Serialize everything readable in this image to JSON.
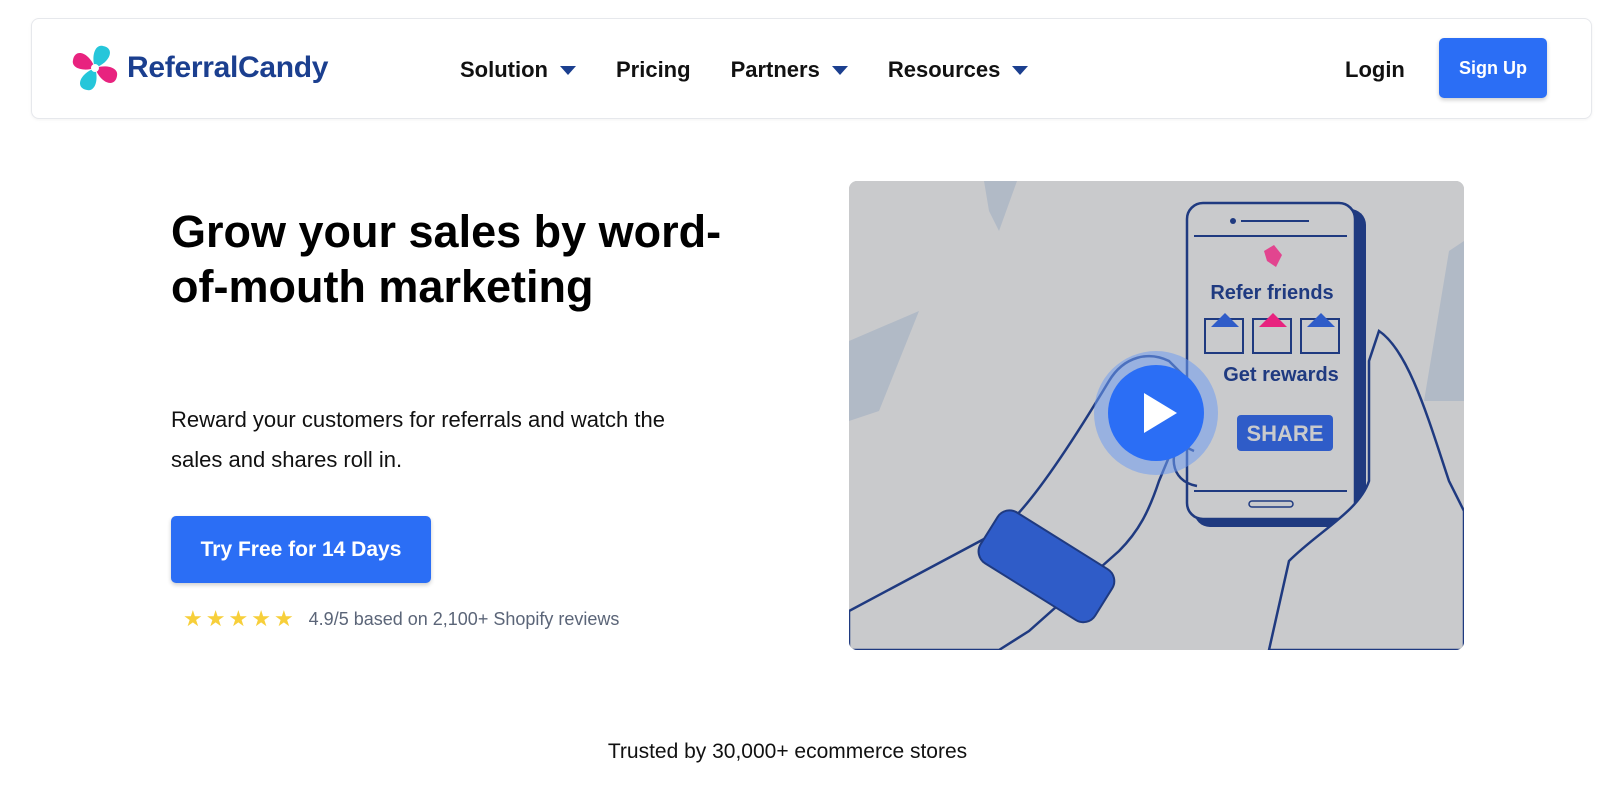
{
  "header": {
    "logo_text": "ReferralCandy",
    "nav": [
      {
        "label": "Solution",
        "has_dropdown": true
      },
      {
        "label": "Pricing",
        "has_dropdown": false
      },
      {
        "label": "Partners",
        "has_dropdown": true
      },
      {
        "label": "Resources",
        "has_dropdown": true
      }
    ],
    "login_label": "Login",
    "signup_label": "Sign Up"
  },
  "hero": {
    "headline": "Grow your sales by word-of-mouth marketing",
    "subtext": "Reward your customers for referrals and watch the sales and shares roll in.",
    "cta_label": "Try Free for 14 Days",
    "rating": {
      "stars": 5,
      "text": "4.9/5 based on 2,100+ Shopify reviews"
    }
  },
  "video": {
    "phone_title": "Refer friends",
    "phone_subtitle": "Get rewards",
    "share_label": "SHARE",
    "play_icon": "play-icon"
  },
  "trust": {
    "text": "Trusted by 30,000+ ecommerce stores"
  },
  "colors": {
    "brand_blue": "#2b6ef5",
    "logo_navy": "#1b3f8f",
    "logo_pink": "#e8237f",
    "logo_cyan": "#26c6da",
    "star_yellow": "#f7cf3a"
  }
}
